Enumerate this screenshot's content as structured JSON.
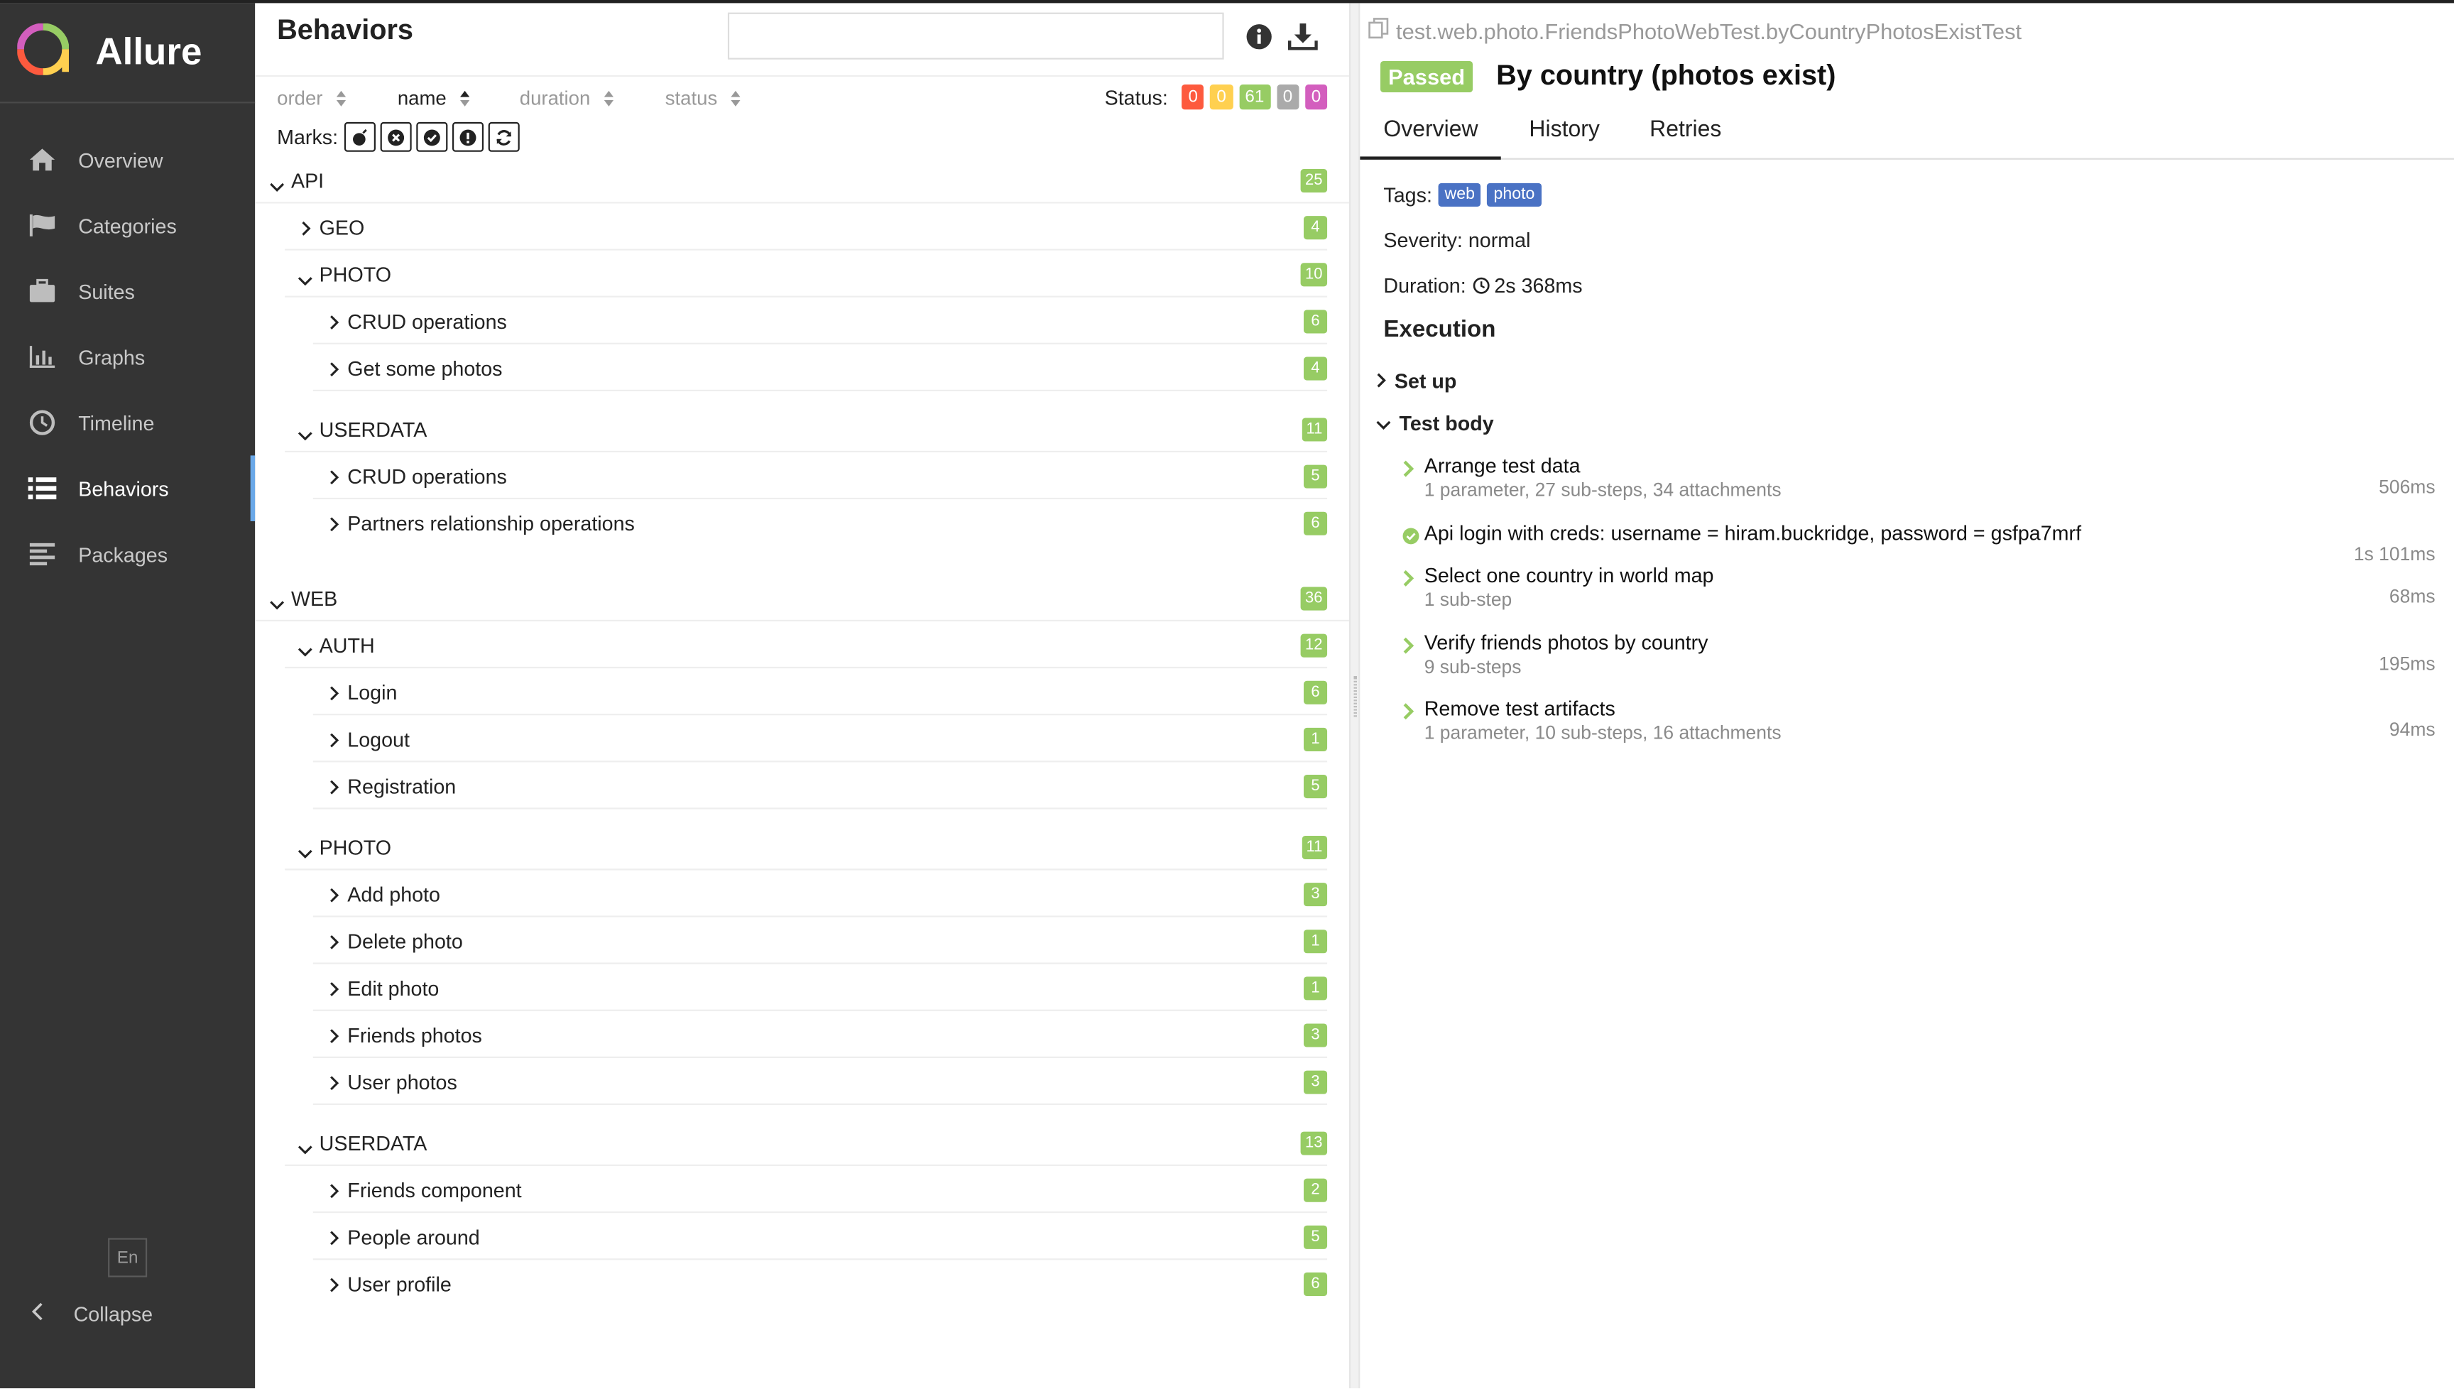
{
  "sidebar": {
    "brand": "Allure",
    "items": [
      {
        "label": "Overview",
        "icon": "home-icon"
      },
      {
        "label": "Categories",
        "icon": "flag-icon"
      },
      {
        "label": "Suites",
        "icon": "briefcase-icon"
      },
      {
        "label": "Graphs",
        "icon": "bar-chart-icon"
      },
      {
        "label": "Timeline",
        "icon": "clock-icon"
      },
      {
        "label": "Behaviors",
        "icon": "list-icon"
      },
      {
        "label": "Packages",
        "icon": "align-left-icon"
      }
    ],
    "active": "Behaviors",
    "lang": "En",
    "collapse": "Collapse"
  },
  "behaviors": {
    "title": "Behaviors",
    "search_placeholder": "",
    "sort": [
      "order",
      "name",
      "duration",
      "status"
    ],
    "sort_active": "name",
    "status_label": "Status:",
    "status_counts": [
      {
        "value": "0",
        "color": "#fd5a3e"
      },
      {
        "value": "0",
        "color": "#ffd050"
      },
      {
        "value": "61",
        "color": "#97cc64"
      },
      {
        "value": "0",
        "color": "#aaaaaa"
      },
      {
        "value": "0",
        "color": "#d35ebe"
      }
    ],
    "marks_label": "Marks:",
    "tree": [
      {
        "label": "API",
        "count": "25"
      },
      {
        "label": "GEO",
        "count": "4"
      },
      {
        "label": "PHOTO",
        "count": "10"
      },
      {
        "label": "CRUD operations",
        "count": "6"
      },
      {
        "label": "Get some photos",
        "count": "4"
      },
      {
        "label": "USERDATA",
        "count": "11"
      },
      {
        "label": "CRUD operations",
        "count": "5"
      },
      {
        "label": "Partners relationship operations",
        "count": "6"
      },
      {
        "label": "WEB",
        "count": "36"
      },
      {
        "label": "AUTH",
        "count": "12"
      },
      {
        "label": "Login",
        "count": "6"
      },
      {
        "label": "Logout",
        "count": "1"
      },
      {
        "label": "Registration",
        "count": "5"
      },
      {
        "label": "PHOTO",
        "count": "11"
      },
      {
        "label": "Add photo",
        "count": "3"
      },
      {
        "label": "Delete photo",
        "count": "1"
      },
      {
        "label": "Edit photo",
        "count": "1"
      },
      {
        "label": "Friends photos",
        "count": "3"
      },
      {
        "label": "User photos",
        "count": "3"
      },
      {
        "label": "USERDATA",
        "count": "13"
      },
      {
        "label": "Friends component",
        "count": "2"
      },
      {
        "label": "People around",
        "count": "5"
      },
      {
        "label": "User profile",
        "count": "6"
      }
    ]
  },
  "detail": {
    "full_name": "test.web.photo.FriendsPhotoWebTest.byCountryPhotosExistTest",
    "status": "Passed",
    "title": "By country (photos exist)",
    "tabs": [
      "Overview",
      "History",
      "Retries"
    ],
    "tags_label": "Tags:",
    "tags": [
      "web",
      "photo"
    ],
    "severity": "Severity: normal",
    "duration_label": "Duration:",
    "duration": "2s 368ms",
    "execution": "Execution",
    "setup": "Set up",
    "test_body": "Test body",
    "steps": [
      {
        "name": "Arrange test data",
        "desc": "1 parameter, 27 sub-steps, 34 attachments",
        "time": "506ms"
      },
      {
        "name": "Api login with creds: username = hiram.buckridge, password = gsfpa7mrf",
        "desc": "",
        "time": "1s 101ms"
      },
      {
        "name": "Select one country in world map",
        "desc": "1 sub-step",
        "time": "68ms"
      },
      {
        "name": "Verify friends photos by country",
        "desc": "9 sub-steps",
        "time": "195ms"
      },
      {
        "name": "Remove test artifacts",
        "desc": "1 parameter, 10 sub-steps, 16 attachments",
        "time": "94ms"
      }
    ]
  }
}
